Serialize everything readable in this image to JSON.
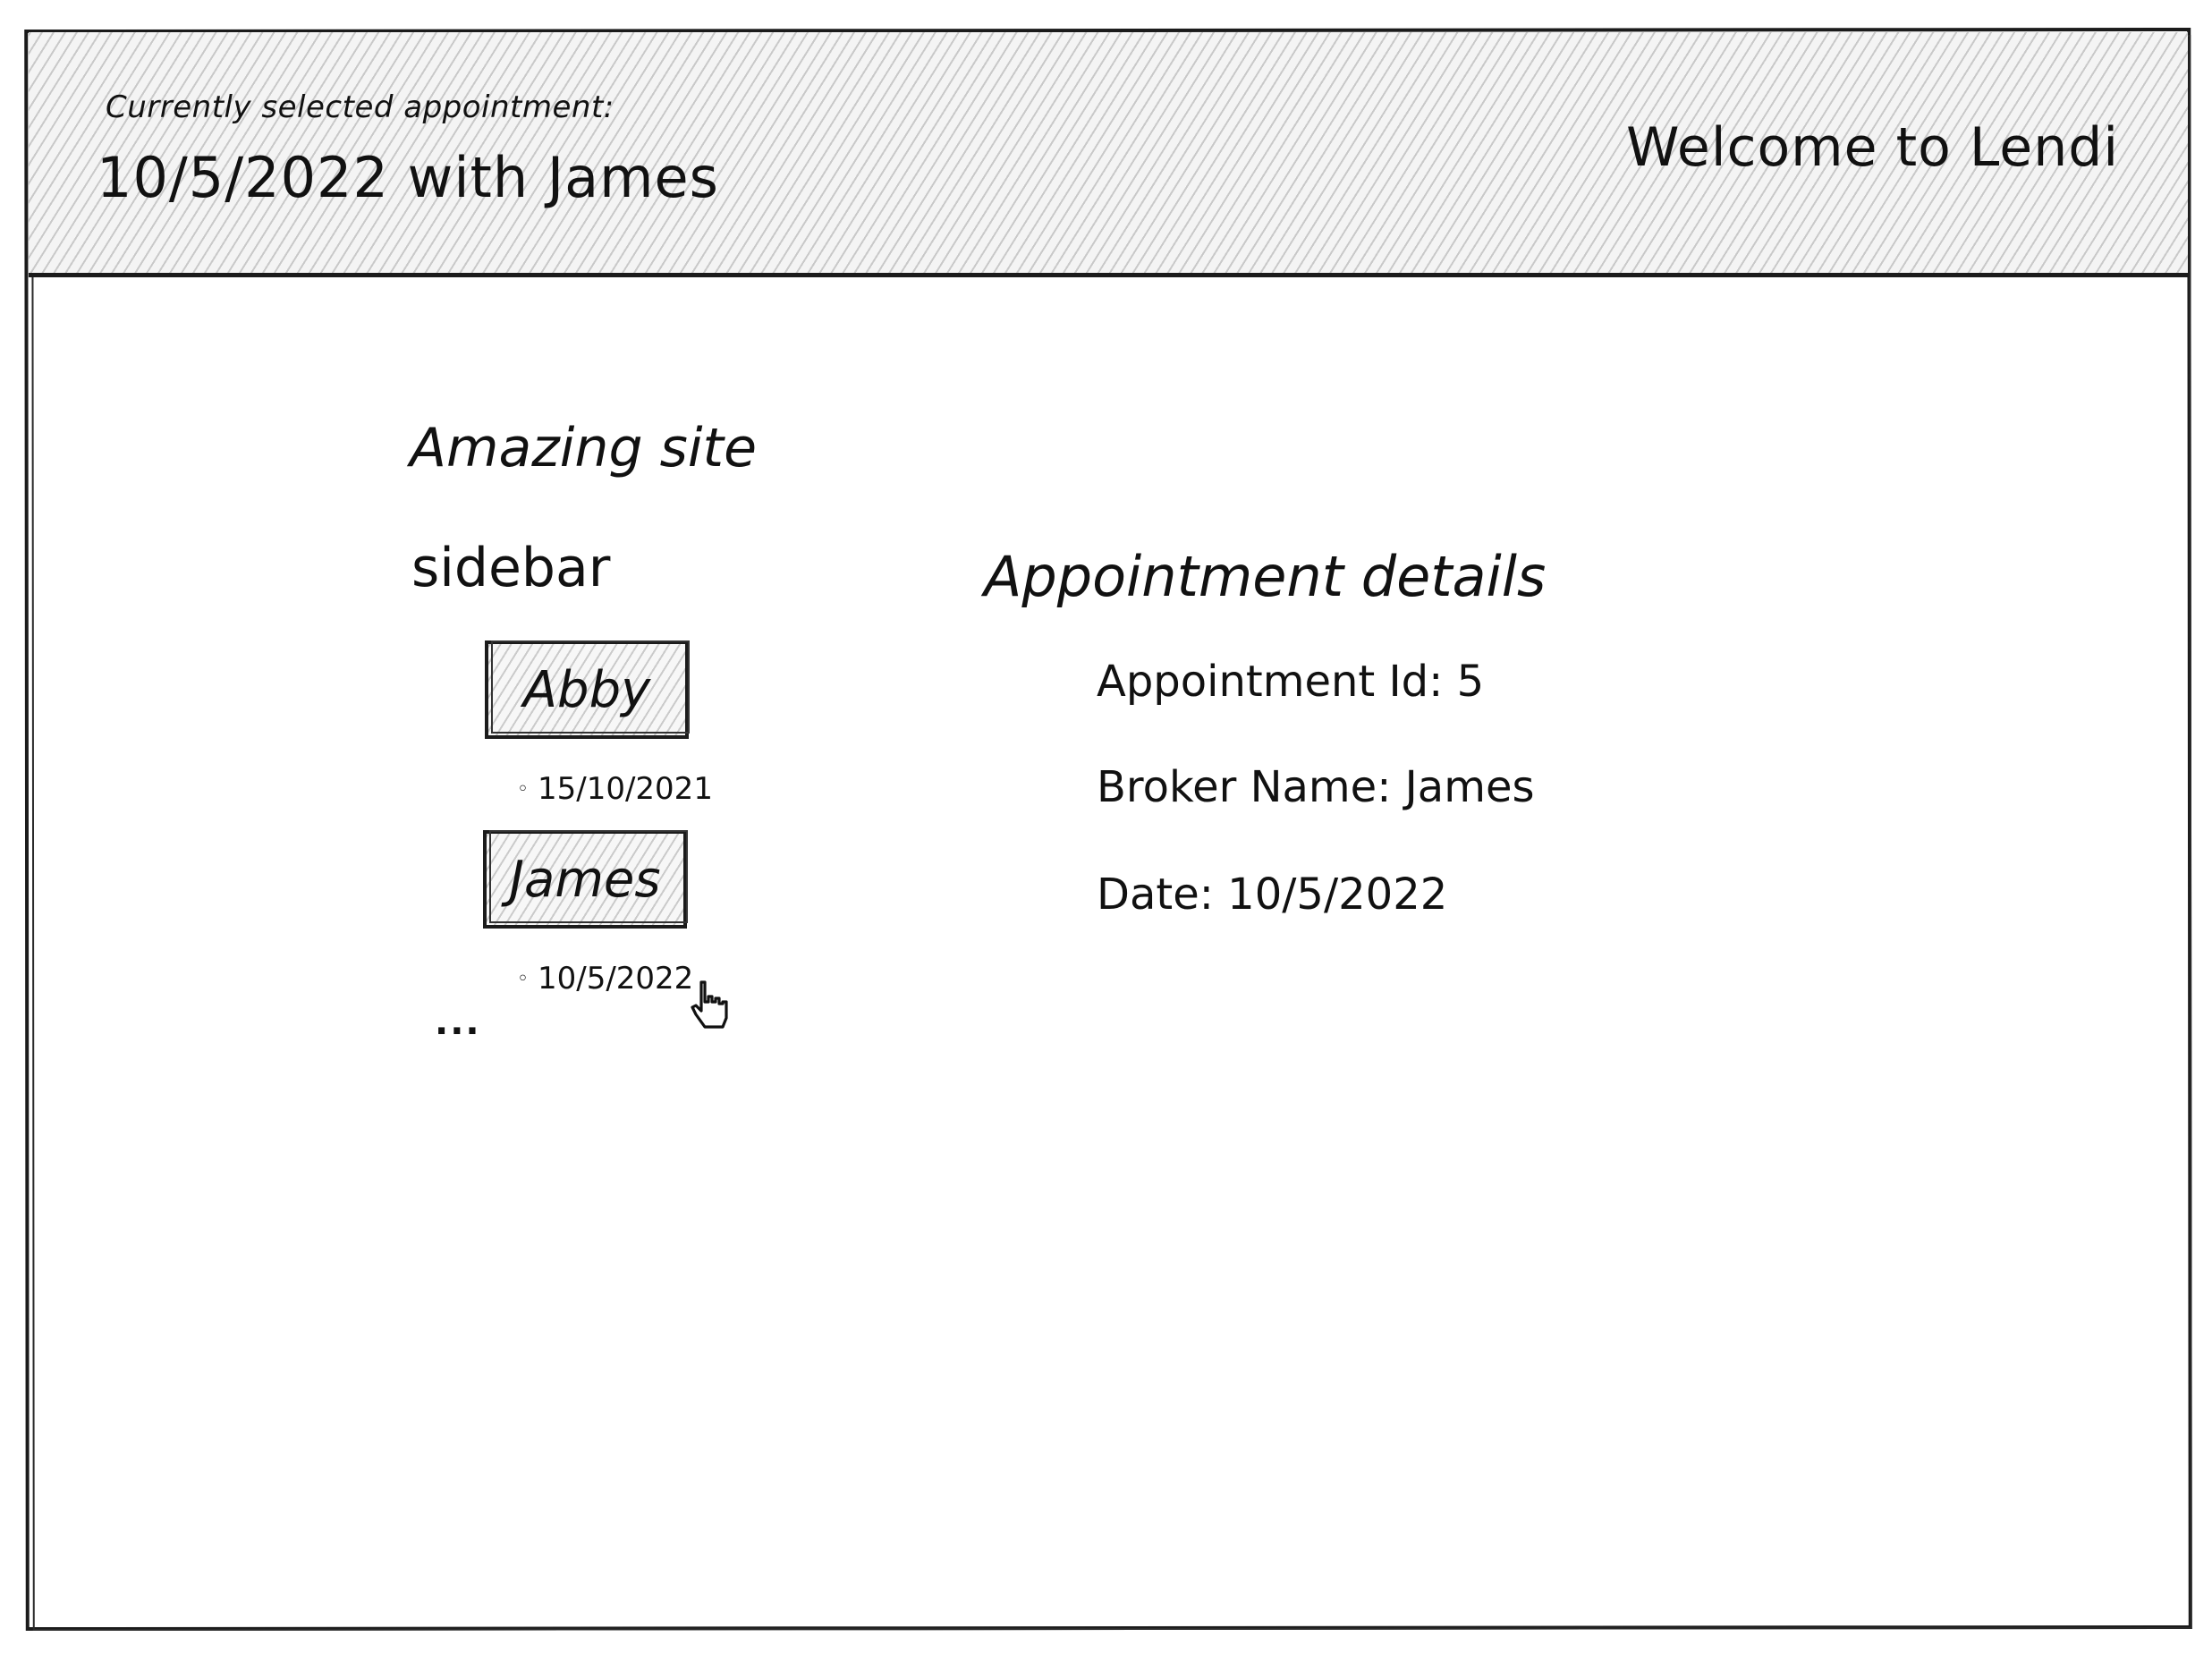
{
  "header": {
    "selected_caption": "Currently selected appointment:",
    "selected_value": "10/5/2022 with James",
    "welcome": "Welcome to Lendi"
  },
  "site_title": "Amazing site",
  "sidebar": {
    "heading": "sidebar",
    "brokers": [
      {
        "name": "Abby",
        "appointment_date": "15/10/2021"
      },
      {
        "name": "James",
        "appointment_date": "10/5/2022"
      }
    ],
    "more": "..."
  },
  "details": {
    "heading": "Appointment details",
    "appointment_id": "Appointment Id: 5",
    "broker_name": "Broker Name: James",
    "date": "Date: 10/5/2022"
  },
  "icons": {
    "cursor": "hand-pointer-icon",
    "bullet": "circle-bullet-icon"
  },
  "colors": {
    "ink": "#111111",
    "hatch": "#787878"
  }
}
